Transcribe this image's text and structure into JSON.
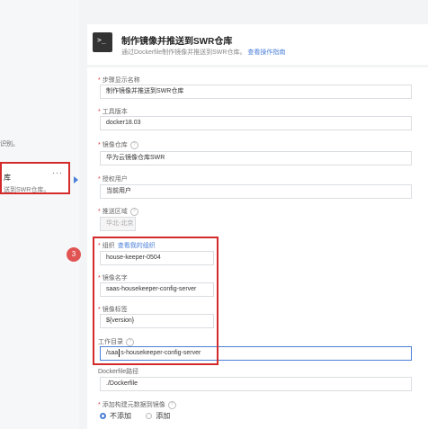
{
  "left": {
    "note": "识别。",
    "step_title": "库",
    "step_desc": "送到SWR仓库。",
    "step_menu": "···"
  },
  "header": {
    "icon_glyph": ">_",
    "title": "制作镜像并推送到SWR仓库",
    "subtitle": "通过Dockerfile制作镜像并推送到SWR仓库。",
    "guide_link": "查看操作指南"
  },
  "form": {
    "step_name_label": "步骤显示名称",
    "step_name_value": "制作镜像并推送到SWR仓库",
    "tool_version_label": "工具版本",
    "tool_version_value": "docker18.03",
    "repo_label": "镜像仓库",
    "repo_value": "华为云镜像仓库SWR",
    "auth_user_label": "授权用户",
    "auth_user_value": "当前用户",
    "region_label": "推送区域",
    "region_value": "华北-北京",
    "org_label": "组织",
    "org_link": "查看我的组织",
    "org_value": "house-keeper-0504",
    "image_name_label": "镜像名字",
    "image_name_value": "saas-housekeeper-config-server",
    "image_tag_label": "镜像标签",
    "image_tag_value": "${version}",
    "workdir_label": "工作目录",
    "workdir_value_prefix": "/saa",
    "workdir_value_suffix": "s-housekeeper-config-server",
    "dockerfile_label": "Dockerfile路径",
    "dockerfile_value": "./Dockerfile",
    "add_meta_label": "添加构建元数据到镜像",
    "radio_no": "不添加",
    "radio_yes": "添加"
  },
  "annotation": {
    "badge_number": "3"
  },
  "colors": {
    "highlight": "#d32b2b",
    "accent": "#4a7fd8",
    "badge": "#e15454"
  }
}
